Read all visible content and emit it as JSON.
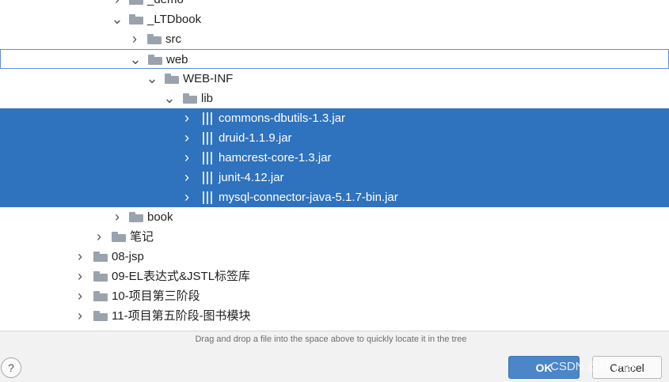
{
  "tree": {
    "rows": [
      {
        "label": "_demo",
        "expanded": false,
        "type": "folder"
      },
      {
        "label": "_LTDbook",
        "expanded": true,
        "type": "folder"
      },
      {
        "label": "src",
        "expanded": false,
        "type": "folder"
      },
      {
        "label": "web",
        "expanded": true,
        "type": "folder",
        "focused": true
      },
      {
        "label": "WEB-INF",
        "expanded": true,
        "type": "folder"
      },
      {
        "label": "lib",
        "expanded": true,
        "type": "folder"
      },
      {
        "label": "commons-dbutils-1.3.jar",
        "expanded": false,
        "type": "jar",
        "selected": true
      },
      {
        "label": "druid-1.1.9.jar",
        "expanded": false,
        "type": "jar",
        "selected": true
      },
      {
        "label": "hamcrest-core-1.3.jar",
        "expanded": false,
        "type": "jar",
        "selected": true
      },
      {
        "label": "junit-4.12.jar",
        "expanded": false,
        "type": "jar",
        "selected": true
      },
      {
        "label": "mysql-connector-java-5.1.7-bin.jar",
        "expanded": false,
        "type": "jar",
        "selected": true
      },
      {
        "label": "book",
        "expanded": false,
        "type": "folder"
      },
      {
        "label": "笔记",
        "expanded": false,
        "type": "folder"
      },
      {
        "label": "08-jsp",
        "expanded": false,
        "type": "folder"
      },
      {
        "label": "09-EL表达式&JSTL标签库",
        "expanded": false,
        "type": "folder"
      },
      {
        "label": "10-项目第三阶段",
        "expanded": false,
        "type": "folder"
      },
      {
        "label": "11-项目第五阶段-图书模块",
        "expanded": false,
        "type": "folder"
      }
    ]
  },
  "footer": {
    "hint": "Drag and drop a file into the space above to quickly locate it in the tree",
    "help_label": "?",
    "ok_label": "OK",
    "cancel_label": "Cancel"
  },
  "watermark": "CSDN @柿子饼",
  "colors": {
    "selection": "#2f72bd",
    "folder": "#9aa3ad",
    "ok_button": "#4a86c8"
  },
  "icons": {
    "collapsed": "chevron-right-icon",
    "expanded": "chevron-down-icon",
    "folder": "folder-icon",
    "jar": "jar-library-icon"
  }
}
